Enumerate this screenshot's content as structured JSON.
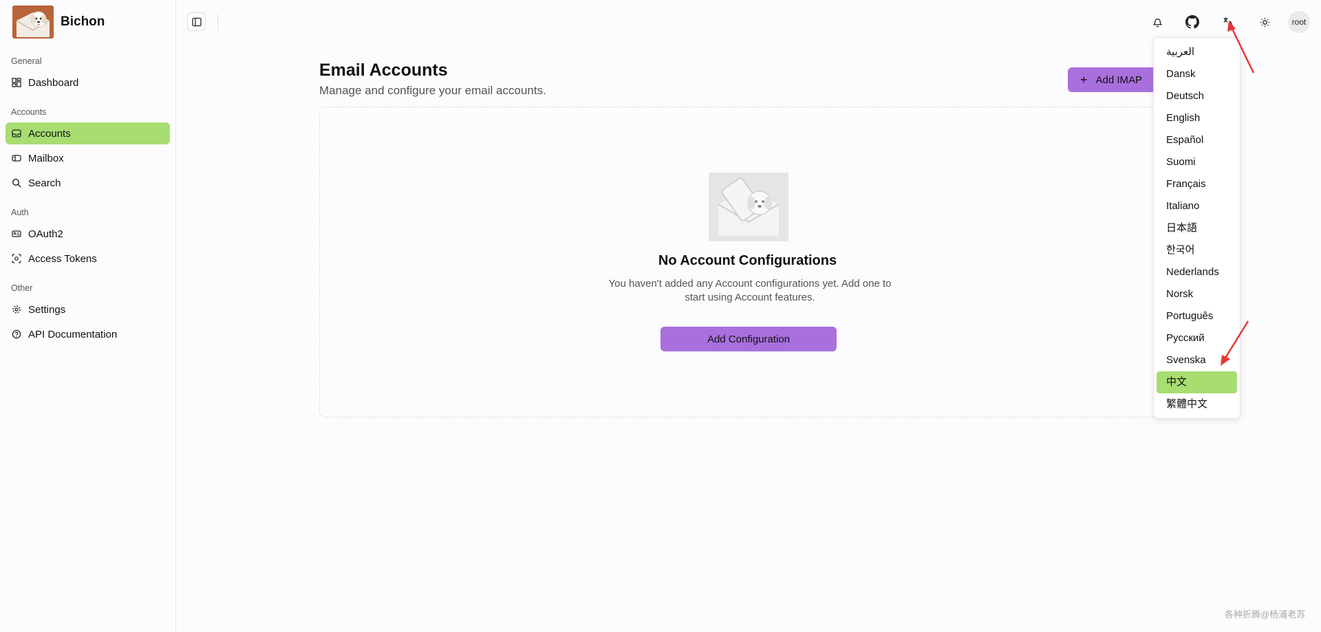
{
  "brand": {
    "name": "Bichon"
  },
  "sidebar": {
    "groups": [
      {
        "label": "General",
        "items": [
          {
            "label": "Dashboard",
            "icon": "dashboard-icon"
          }
        ]
      },
      {
        "label": "Accounts",
        "items": [
          {
            "label": "Accounts",
            "icon": "inbox-icon",
            "active": true
          },
          {
            "label": "Mailbox",
            "icon": "mailbox-icon"
          },
          {
            "label": "Search",
            "icon": "search-icon"
          }
        ]
      },
      {
        "label": "Auth",
        "items": [
          {
            "label": "OAuth2",
            "icon": "id-card-icon"
          },
          {
            "label": "Access Tokens",
            "icon": "scan-face-icon"
          }
        ]
      },
      {
        "label": "Other",
        "items": [
          {
            "label": "Settings",
            "icon": "gear-icon"
          },
          {
            "label": "API Documentation",
            "icon": "help-circle-icon"
          }
        ]
      }
    ]
  },
  "header": {
    "avatar": "root"
  },
  "main": {
    "title": "Email Accounts",
    "subtitle": "Manage and configure your email accounts.",
    "add_imap": "Add IMAP",
    "empty": {
      "title": "No Account Configurations",
      "description": "You haven't added any Account configurations yet. Add one to start using Account features.",
      "button": "Add Configuration"
    }
  },
  "language_menu": {
    "items": [
      "العربية",
      "Dansk",
      "Deutsch",
      "English",
      "Español",
      "Suomi",
      "Français",
      "Italiano",
      "日本語",
      "한국어",
      "Nederlands",
      "Norsk",
      "Português",
      "Русский",
      "Svenska",
      "中文",
      "繁體中文"
    ],
    "selected_index": 15
  },
  "watermark": "各种折腾@杨浦老苏",
  "colors": {
    "accent_green": "#a8dd72",
    "accent_purple": "#a970dd"
  }
}
